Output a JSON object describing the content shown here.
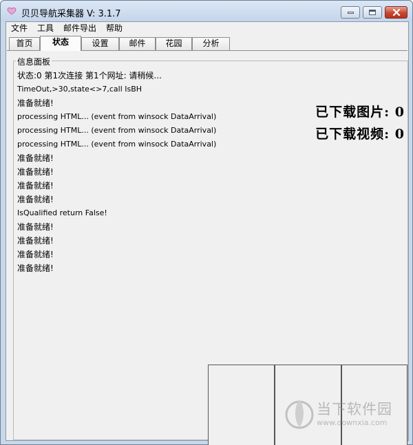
{
  "window": {
    "title": "贝贝导航采集器 V: 3.1.7"
  },
  "menu": [
    "文件",
    "工具",
    "邮件导出",
    "帮助"
  ],
  "tabs": [
    {
      "label": "首页",
      "active": false
    },
    {
      "label": "状态",
      "active": true
    },
    {
      "label": "设置",
      "active": false
    },
    {
      "label": "邮件",
      "active": false
    },
    {
      "label": "花园",
      "active": false
    },
    {
      "label": "分析",
      "active": false
    }
  ],
  "panel": {
    "legend": "信息面板",
    "log": [
      "状态:0 第1次连接 第1个网址: 请稍候...",
      "TimeOut,>30,state<>7,call IsBH",
      "准备就绪!",
      "processing HTML... (event from winsock DataArrival)",
      "processing HTML... (event from winsock DataArrival)",
      "processing HTML... (event from winsock DataArrival)",
      "准备就绪!",
      "准备就绪!",
      "准备就绪!",
      "准备就绪!",
      "IsQualified return False!",
      "准备就绪!",
      "准备就绪!",
      "准备就绪!",
      "准备就绪!"
    ],
    "stats": {
      "images_label": "已下载图片:",
      "images_count": "0",
      "videos_label": "已下载视频:",
      "videos_count": "0"
    }
  },
  "watermark": {
    "brand": "当下软件园",
    "url": "www.downxia.com"
  },
  "colors": {
    "frame": "#c9d8e9",
    "close_button": "#c7462f",
    "panel_bg": "#f0f0f0"
  }
}
